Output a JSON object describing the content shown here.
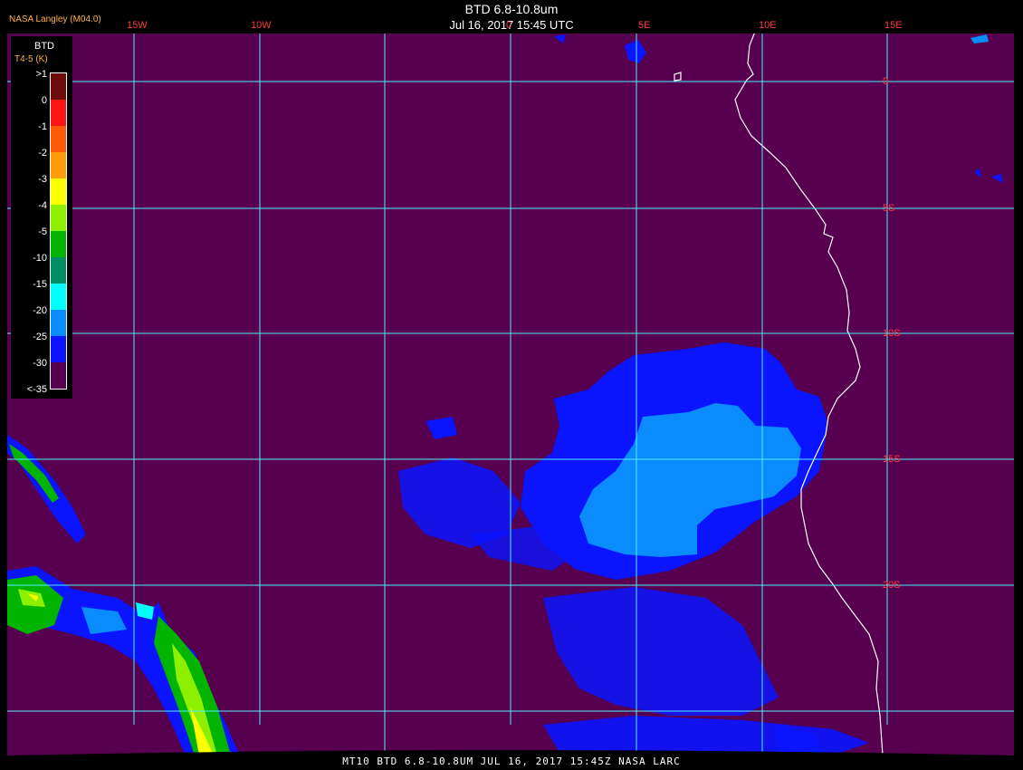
{
  "header": {
    "source": "NASA Langley (M04.0)",
    "title": "BTD 6.8-10.8um",
    "datetime": "Jul 16, 2017 15:45 UTC"
  },
  "legend": {
    "title": "BTD",
    "units": "T4-5 (K)",
    "labels": [
      ">1",
      "0",
      "-1",
      "-2",
      "-3",
      "-4",
      "-5",
      "-10",
      "-15",
      "-20",
      "-25",
      "-30",
      "<-35"
    ],
    "colors": [
      "#6e0b0b",
      "#ff1414",
      "#ff5a0a",
      "#ff9c0a",
      "#ffff00",
      "#8cf000",
      "#00b400",
      "#008c64",
      "#00ffff",
      "#0a8cff",
      "#0a14ff",
      "#56004f"
    ]
  },
  "grid": {
    "longitude_labels": [
      "15W",
      "10W",
      "0",
      "5E",
      "10E",
      "15E"
    ],
    "latitude_labels": [
      "0",
      "5S",
      "10S",
      "15S",
      "20S"
    ]
  },
  "footer": "MT10  BTD 6.8-10.8UM   JUL 16, 2017 15:45Z   NASA LARC",
  "colors": {
    "background": "#56004f",
    "gridline": "#4ff0ff",
    "coastline": "#ffffff",
    "tick_label": "#ff3a3a"
  }
}
